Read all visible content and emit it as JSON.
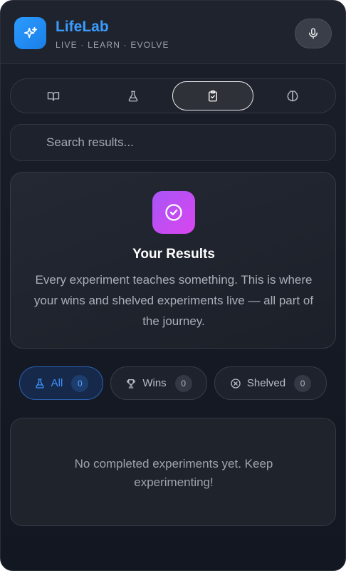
{
  "header": {
    "title": "LifeLab",
    "subtitle": "LIVE · LEARN · EVOLVE",
    "logo_icon": "sparkles-icon",
    "mic_icon": "microphone-icon"
  },
  "tabs": [
    {
      "icon": "book-icon",
      "active": false
    },
    {
      "icon": "flask-icon",
      "active": false
    },
    {
      "icon": "clipboard-check-icon",
      "active": true
    },
    {
      "icon": "brain-icon",
      "active": false
    }
  ],
  "search": {
    "placeholder": "Search results..."
  },
  "hero": {
    "icon": "check-circle-icon",
    "title": "Your Results",
    "description": "Every experiment teaches something. This is where your wins and shelved experiments live — all part of the journey."
  },
  "filters": [
    {
      "label": "All",
      "count": "0",
      "icon": "flask-icon",
      "active": true
    },
    {
      "label": "Wins",
      "count": "0",
      "icon": "trophy-icon",
      "active": false
    },
    {
      "label": "Shelved",
      "count": "0",
      "icon": "x-circle-icon",
      "active": false
    }
  ],
  "empty_state": {
    "message": "No completed experiments yet. Keep experimenting!"
  },
  "colors": {
    "accent": "#2b9bff",
    "hero_gradient_start": "#a855f7",
    "hero_gradient_end": "#d946ef"
  }
}
